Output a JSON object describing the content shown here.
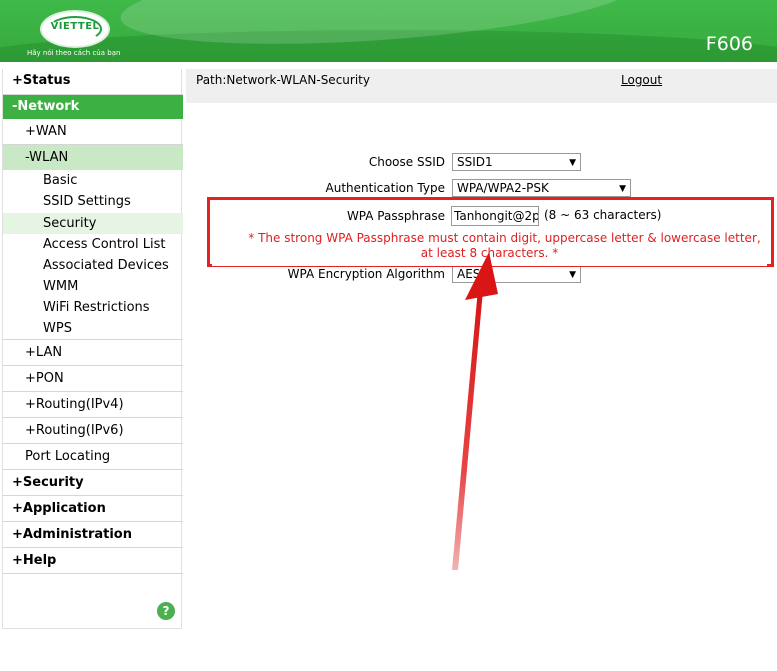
{
  "header": {
    "logo_text": "VIETTEL",
    "slogan": "Hãy nói theo cách của bạn",
    "model": "F606"
  },
  "sidebar": {
    "status": "Status",
    "network": "Network",
    "wan": "WAN",
    "wlan": "WLAN",
    "wlan_items": {
      "basic": "Basic",
      "ssid_settings": "SSID Settings",
      "security": "Security",
      "acl": "Access Control List",
      "assoc": "Associated Devices",
      "wmm": "WMM",
      "wifi_restr": "WiFi Restrictions",
      "wps": "WPS"
    },
    "lan": "LAN",
    "pon": "PON",
    "routing4": "Routing(IPv4)",
    "routing6": "Routing(IPv6)",
    "port_locating": "Port Locating",
    "security": "Security",
    "application": "Application",
    "administration": "Administration",
    "help": "Help",
    "plus": "+",
    "minus": "-",
    "help_icon": "?"
  },
  "path": {
    "text": "Path:Network-WLAN-Security",
    "logout": "Logout"
  },
  "form": {
    "choose_ssid_label": "Choose SSID",
    "choose_ssid_value": "SSID1",
    "auth_label": "Authentication Type",
    "auth_value": "WPA/WPA2-PSK",
    "pass_label": "WPA Passphrase",
    "pass_value": "Tanhongit@2p",
    "pass_hint": "(8 ~ 63 characters)",
    "warning_line1": "* The strong WPA Passphrase must contain digit, uppercase letter & lowercase letter,",
    "warning_line2": "at least 8 characters. *",
    "enc_label": "WPA Encryption Algorithm",
    "enc_value": "AES"
  },
  "colors": {
    "brand_green": "#3cb043",
    "warning_red": "#e02020",
    "annotation_red": "#e32222"
  }
}
